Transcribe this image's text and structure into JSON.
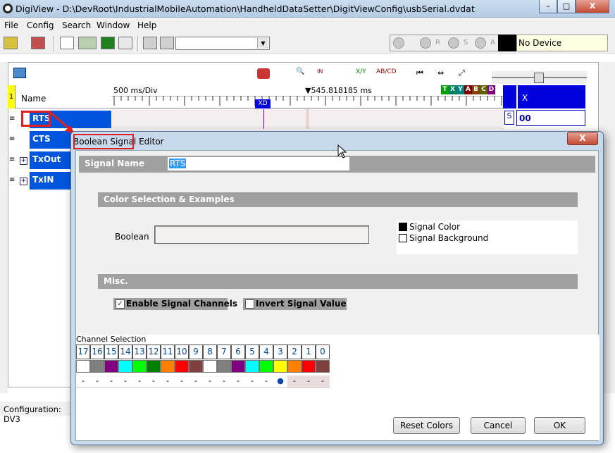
{
  "window": {
    "title": "DigiView - D:\\DevRoot\\IndustrialMobileAutomation\\HandheldDataSetter\\DigitViewConfig\\usbSerial.dvdat",
    "min": "–",
    "max": "□",
    "close": "X"
  },
  "menu": [
    "File",
    "Config",
    "Search",
    "Window",
    "Help"
  ],
  "device": {
    "status": "No Device",
    "letters": [
      "R",
      "S",
      "A"
    ]
  },
  "header": {
    "name_label": "Name",
    "row_index": "1",
    "time_div": "500 ms/Div",
    "cursor_time": "▼545.818185 ms",
    "x_label": "X",
    "x_value": "00",
    "legend": [
      "T",
      "X",
      "Y",
      "A",
      "B",
      "C",
      "D"
    ],
    "xd_marker": "XD",
    "toggle_marker": "S"
  },
  "signals": [
    "RTS",
    "CTS",
    "TxOut",
    "TxIN"
  ],
  "status": {
    "configuration": "Configuration:  DV3"
  },
  "dialog": {
    "title": "Boolean Signal Editor",
    "close": "X",
    "signal_name_label": "Signal Name",
    "signal_name_value": "RTS",
    "color_section": "Color Selection & Examples",
    "boolean_label": "Boolean",
    "signal_color": "Signal Color",
    "signal_background": "Signal Background",
    "misc_section": "Misc.",
    "enable_channels": "Enable Signal Channels",
    "enable_channels_checked": true,
    "invert_value": "Invert  Signal Value",
    "invert_value_checked": false,
    "channel_selection": "Channel Selection",
    "channels": [
      "17",
      "16",
      "15",
      "14",
      "13",
      "12",
      "11",
      "10",
      "9",
      "8",
      "7",
      "6",
      "5",
      "4",
      "3",
      "2",
      "1",
      "0"
    ],
    "channel_colors": [
      "#ffffff",
      "#808080",
      "#800080",
      "#00ffff",
      "#00ff00",
      "#008000",
      "#ff8000",
      "#ff0000",
      "#804040",
      "#ffffff",
      "#808080",
      "#800080",
      "#00ffff",
      "#00ff00",
      "#ffff00",
      "#ff8000",
      "#ff0000",
      "#804040"
    ],
    "channel_marks": [
      "-",
      "-",
      "-",
      "-",
      "-",
      "-",
      "-",
      "-",
      "-",
      "-",
      "-",
      "-",
      "-",
      "-",
      "●",
      "-",
      "-",
      "-"
    ],
    "buttons": {
      "reset": "Reset Colors",
      "cancel": "Cancel",
      "ok": "OK"
    }
  }
}
